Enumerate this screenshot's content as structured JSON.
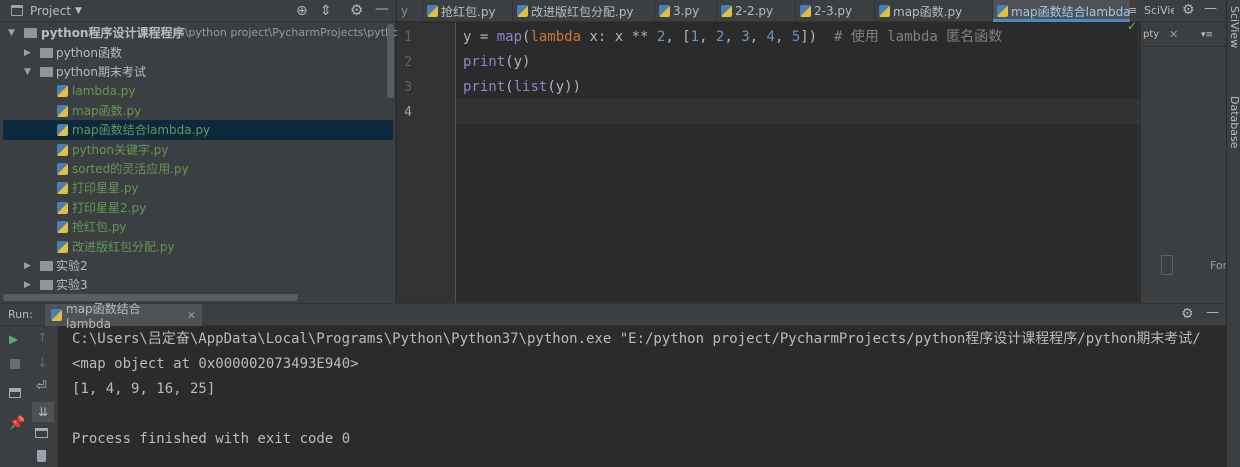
{
  "project_panel": {
    "title": "Project",
    "root_name": "python程序设计课程程序",
    "root_path": "E:\\python project\\PycharmProjects\\pytho",
    "tree": [
      {
        "label": "python函数",
        "type": "folder",
        "indent": 1,
        "arrow": "▶"
      },
      {
        "label": "python期末考试",
        "type": "folder",
        "indent": 1,
        "arrow": "▼"
      },
      {
        "label": "lambda.py",
        "type": "file",
        "indent": 2
      },
      {
        "label": "map函数.py",
        "type": "file",
        "indent": 2
      },
      {
        "label": "map函数结合lambda.py",
        "type": "file",
        "indent": 2,
        "selected": true
      },
      {
        "label": "python关键字.py",
        "type": "file",
        "indent": 2
      },
      {
        "label": "sorted的灵活应用.py",
        "type": "file",
        "indent": 2
      },
      {
        "label": "打印星星.py",
        "type": "file",
        "indent": 2
      },
      {
        "label": "打印星星2.py",
        "type": "file",
        "indent": 2
      },
      {
        "label": "抢红包.py",
        "type": "file",
        "indent": 2
      },
      {
        "label": "改进版红包分配.py",
        "type": "file",
        "indent": 2
      },
      {
        "label": "实验2",
        "type": "folder",
        "indent": 1,
        "arrow": "▶"
      },
      {
        "label": "实验3",
        "type": "folder",
        "indent": 1,
        "arrow": "▶"
      }
    ]
  },
  "editor": {
    "tab_overflow": "y",
    "tabs": [
      {
        "label": "抢红包.py"
      },
      {
        "label": "改进版红包分配.py"
      },
      {
        "label": "3.py"
      },
      {
        "label": "2-2.py"
      },
      {
        "label": "2-3.py"
      },
      {
        "label": "map函数.py"
      },
      {
        "label": "map函数结合lambda.py",
        "active": true
      }
    ],
    "line_numbers": [
      "1",
      "2",
      "3",
      "4"
    ],
    "code": [
      {
        "text": "y = map(lambda x: x ** 2, [1, 2, 3, 4, 5])  # 使用 lambda 匿名函数"
      },
      {
        "text": "print(y)"
      },
      {
        "text": "print(list(y))"
      },
      {
        "text": ""
      }
    ],
    "inspection_mark": "✓"
  },
  "sciview": {
    "tab_label": "SciView",
    "subtab": "pty",
    "footer_text": "For"
  },
  "right_strip": [
    "SciView",
    "Database"
  ],
  "run_panel": {
    "label": "Run:",
    "tab_label": "map函数结合lambda",
    "console": [
      "C:\\Users\\吕定奋\\AppData\\Local\\Programs\\Python\\Python37\\python.exe \"E:/python project/PycharmProjects/python程序设计课程程序/python期末考试/",
      "<map object at 0x000002073493E940>",
      "[1, 4, 9, 16, 25]",
      "",
      "Process finished with exit code 0"
    ]
  },
  "colors": {
    "background": "#2b2b2b",
    "panel": "#3c3f41",
    "selection": "#0d293e",
    "keyword": "#cc7832",
    "number": "#6897bb",
    "builtin": "#8888c6",
    "comment": "#808080",
    "file_green": "#629755"
  }
}
